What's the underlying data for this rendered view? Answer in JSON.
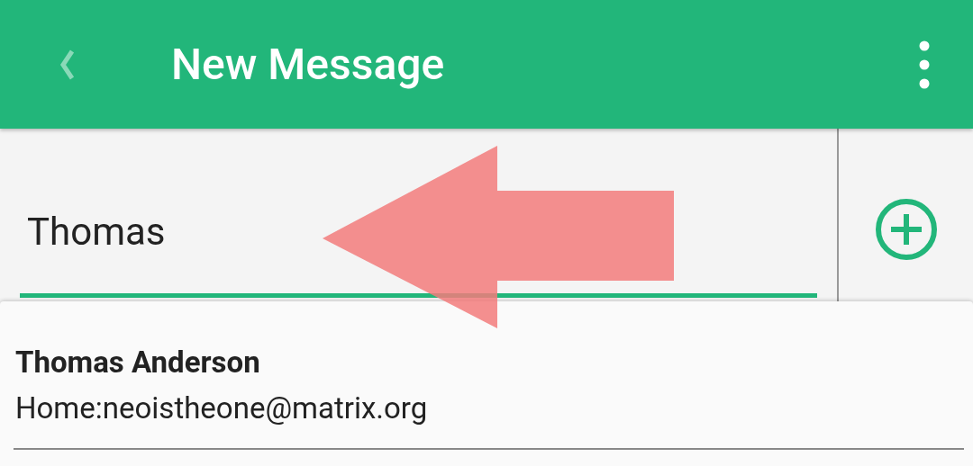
{
  "app_bar": {
    "title": "New Message"
  },
  "recipient_field": {
    "value": "Thomas"
  },
  "suggestions": [
    {
      "name": "Thomas Anderson",
      "detail": "Home:neoistheone@matrix.org"
    }
  ]
}
